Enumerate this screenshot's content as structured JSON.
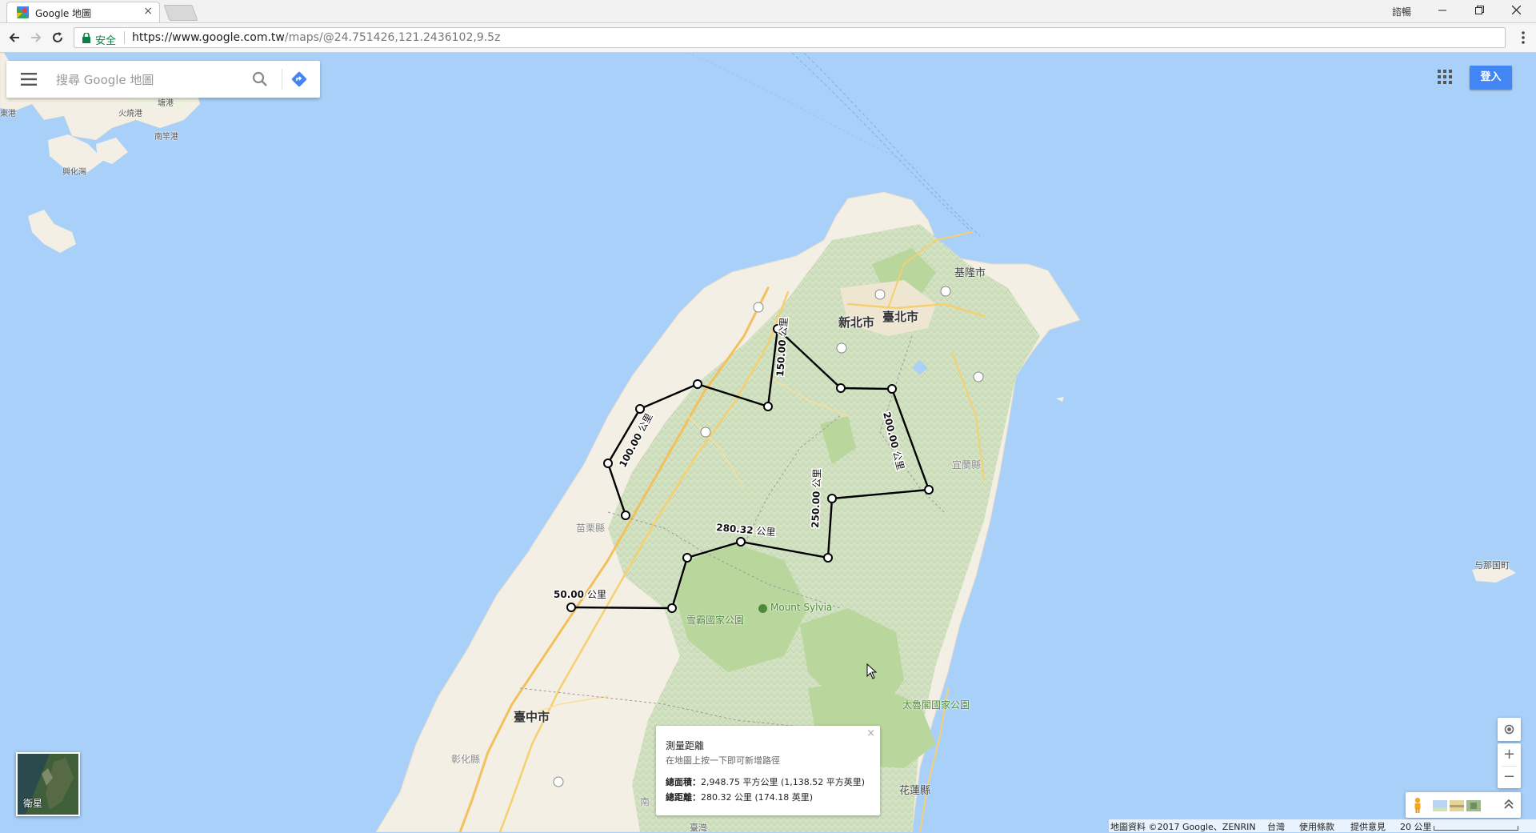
{
  "browser": {
    "tab_title": "Google 地圖",
    "close_glyph": "×",
    "user_label": "諮暢",
    "secure_label": "安全",
    "url_host": "https://www.google.com.tw",
    "url_path": "/maps/@24.751426,121.2436102,9.5z",
    "controls": [
      "minimize-icon",
      "restore-icon",
      "close-icon"
    ]
  },
  "search": {
    "placeholder": "搜尋 Google 地圖",
    "icon": "search-icon",
    "directions_icon": "directions-icon"
  },
  "header": {
    "signin_label": "登入",
    "apps_icon": "apps-grid-icon"
  },
  "satellite": {
    "label": "衛星"
  },
  "measure": {
    "title": "測量距離",
    "hint": "在地圖上按一下即可新增路徑",
    "area_label": "總面積：",
    "area_value": "2,948.75 平方公里 (1,138.52 平方英里)",
    "distance_label": "總距離：",
    "distance_value": "280.32 公里 (174.18 英里)",
    "close_glyph": "×"
  },
  "path_labels": [
    {
      "value": "50.00",
      "unit": "公里"
    },
    {
      "value": "100.00",
      "unit": "公里"
    },
    {
      "value": "150.00",
      "unit": "公里"
    },
    {
      "value": "200.00",
      "unit": "公里"
    },
    {
      "value": "250.00",
      "unit": "公里"
    },
    {
      "value": "280.32",
      "unit": "公里"
    }
  ],
  "place_labels": {
    "new_taipei": "新北市",
    "taipei": "臺北市",
    "keelung": "基隆市",
    "yilan": "宜蘭縣",
    "miaoli": "苗栗縣",
    "shei_pa": "雪霸國家公園",
    "mount_sylvia": "Mount Sylvia",
    "taichung": "臺中市",
    "changhua": "彰化縣",
    "hualien": "花蓮縣",
    "taroko": "太魯閣國家公園",
    "taiwan": "臺灣",
    "yonaguni": "与那国町",
    "nan_prefix": "南",
    "matsu_1": "塘港",
    "matsu_2": "火燒港",
    "matsu_3": "南竿港",
    "matsu_4": "興化灣",
    "matsu_5": "東港"
  },
  "map_controls": {
    "zoom_in": "+",
    "zoom_out": "−",
    "locate_icon": "my-location-icon",
    "pegman_icon": "pegman-icon",
    "expand_icon": "chevron-up-icon"
  },
  "footer": {
    "attribution": "地圖資料 ©2017 Google、ZENRIN",
    "region": "台灣",
    "terms": "使用條款",
    "feedback": "提供意見",
    "scale": "20 公里"
  },
  "colors": {
    "water": "#a9d0f8",
    "land": "#f4efe4",
    "forest": "#c9dfb4",
    "accent": "#4285f4",
    "secure": "#0b8043"
  }
}
